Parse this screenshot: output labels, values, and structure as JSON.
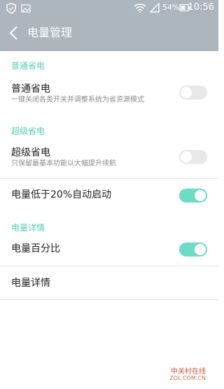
{
  "status_bar": {
    "battery_percent": "54%",
    "time": "10:56",
    "icons": [
      "shield-icon",
      "image-icon",
      "wifi-icon",
      "signal-icon",
      "battery-icon"
    ]
  },
  "header": {
    "title": "电量管理",
    "back_icon": "back-arrow-icon"
  },
  "sections": [
    {
      "title": "普通省电",
      "items": [
        {
          "label": "普通省电",
          "subtitle": "一键关闭各类开关并调整系统为省资源模式",
          "toggle": false
        }
      ]
    },
    {
      "title": "超级省电",
      "items": [
        {
          "label": "超级省电",
          "subtitle": "只保留最基本功能以大幅提升续航",
          "toggle": false
        },
        {
          "label": "电量低于20%自动启动",
          "toggle": true
        }
      ]
    },
    {
      "title": "电量详情",
      "items": [
        {
          "label": "电量百分比",
          "toggle": true
        },
        {
          "label": "电量详情"
        }
      ]
    }
  ],
  "watermark": {
    "text": "中关村在线",
    "url": "ZOL.COM.CN"
  },
  "colors": {
    "header_background": "#adb6bc",
    "accent": "#59cdb9",
    "toggle_on": "#6ddcc7",
    "toggle_off": "#e8e8e8"
  }
}
